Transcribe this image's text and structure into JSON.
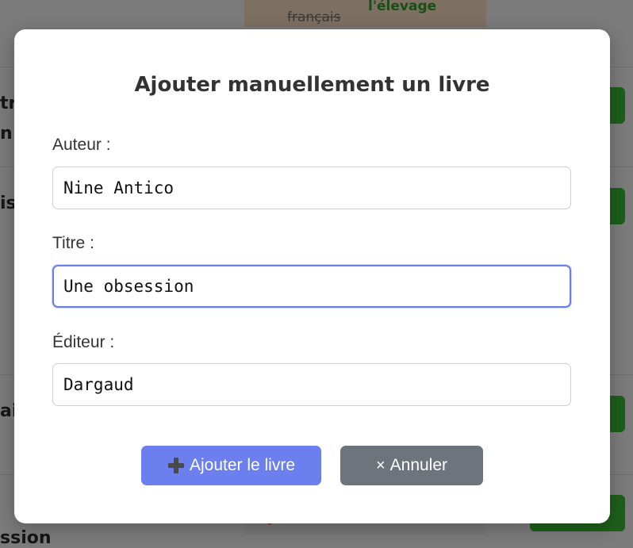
{
  "background": {
    "card_strike_text": "français",
    "card_green_text": "l'élevage",
    "row_labels": [
      "tr",
      "n a",
      "is",
      "ai",
      "ssion"
    ]
  },
  "modal": {
    "title": "Ajouter manuellement un livre",
    "fields": [
      {
        "label": "Auteur :",
        "value": "Nine Antico"
      },
      {
        "label": "Titre :",
        "value": "Une obsession"
      },
      {
        "label": "Éditeur :",
        "value": "Dargaud"
      }
    ],
    "add_button": {
      "icon": "plus-icon",
      "label": "Ajouter le livre"
    },
    "cancel_button": {
      "icon": "x-icon",
      "symbol": "×",
      "label": "Annuler"
    }
  },
  "colors": {
    "overlay": "#7b7b7b",
    "primary": "#6b7fee",
    "secondary": "#6d747c",
    "focus_border": "#6b7fe6"
  }
}
